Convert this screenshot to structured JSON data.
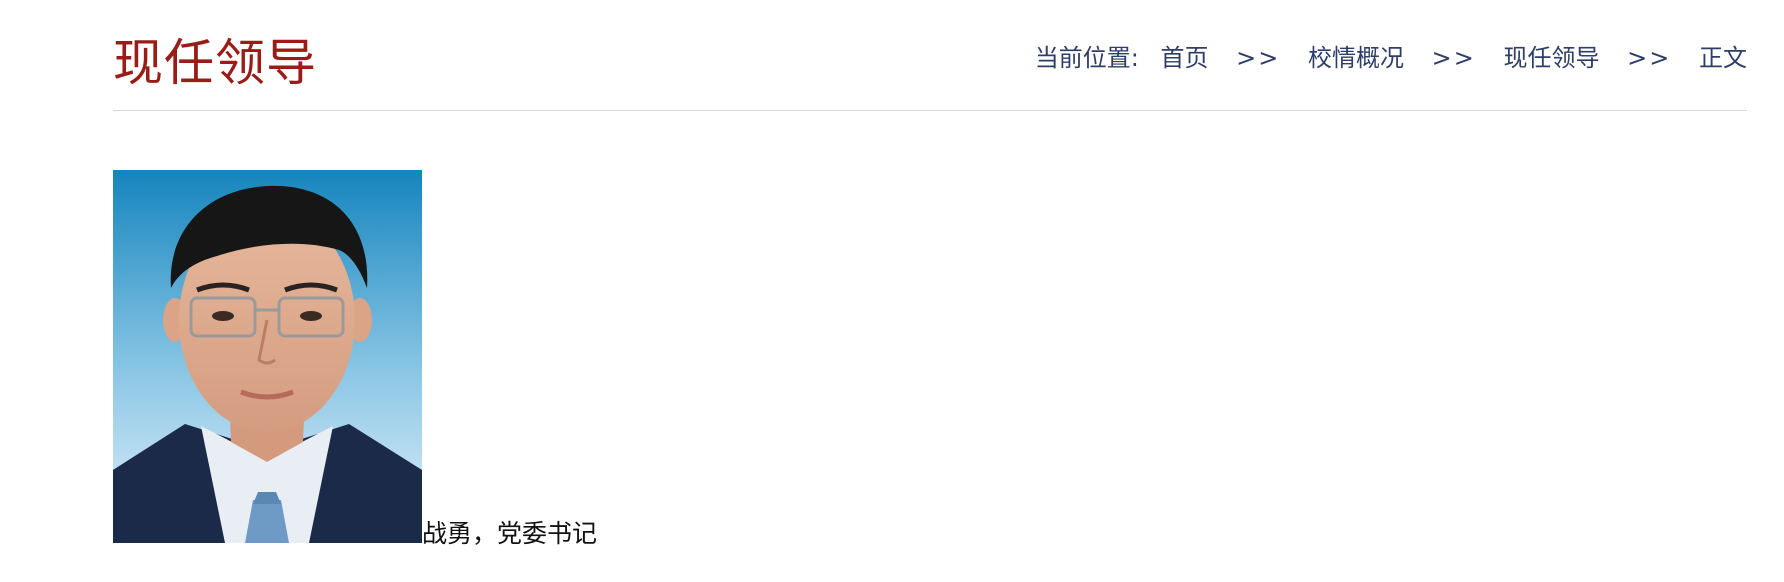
{
  "page": {
    "title": "现任领导"
  },
  "breadcrumb": {
    "label": "当前位置:",
    "items": [
      "首页",
      "校情概况",
      "现任领导"
    ],
    "separator": ">>",
    "current": "正文"
  },
  "article": {
    "caption": "战勇，党委书记"
  },
  "colors": {
    "title": "#9a1c16",
    "breadcrumb": "#2e3e66",
    "divider": "#d8d8d8",
    "portrait_background_top": "#1a86c0",
    "portrait_background_bottom": "#e8f3fb",
    "suit": "#1c2a4a"
  }
}
